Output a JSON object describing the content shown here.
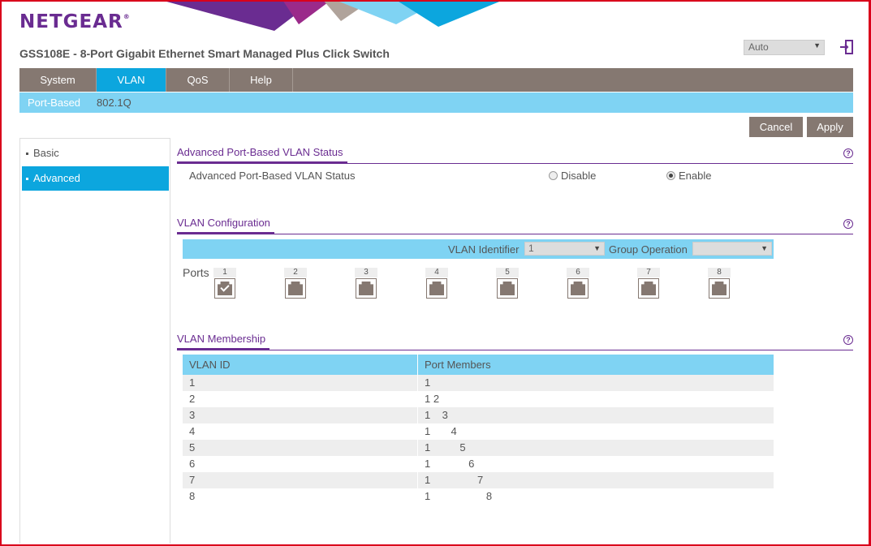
{
  "brand": {
    "logo": "NETGEAR",
    "trademark": "®",
    "colors": {
      "purple": "#6a2c91",
      "blue": "#0ca6de",
      "light_blue": "#7fd3f3",
      "taupe": "#857871"
    }
  },
  "product_title": "GSS108E - 8-Port Gigabit Ethernet Smart Managed Plus Click Switch",
  "language_select": {
    "value": "Auto"
  },
  "logout_icon": "logout-icon",
  "main_nav": [
    {
      "label": "System",
      "active": false
    },
    {
      "label": "VLAN",
      "active": true
    },
    {
      "label": "QoS",
      "active": false
    },
    {
      "label": "Help",
      "active": false
    }
  ],
  "sub_nav": [
    {
      "label": "Port-Based",
      "active": true
    },
    {
      "label": "802.1Q",
      "active": false
    }
  ],
  "buttons": {
    "cancel": "Cancel",
    "apply": "Apply"
  },
  "left_menu": [
    {
      "label": "Basic",
      "active": false
    },
    {
      "label": "Advanced",
      "active": true
    }
  ],
  "status_section": {
    "title": "Advanced Port-Based VLAN Status",
    "row_label": "Advanced Port-Based VLAN Status",
    "options": [
      {
        "label": "Disable",
        "selected": false
      },
      {
        "label": "Enable",
        "selected": true
      }
    ]
  },
  "config_section": {
    "title": "VLAN Configuration",
    "vlan_identifier_label": "VLAN Identifier",
    "vlan_identifier_value": "1",
    "group_operation_label": "Group Operation",
    "group_operation_value": "",
    "ports_label": "Ports",
    "ports": [
      {
        "num": "1",
        "checked": true
      },
      {
        "num": "2",
        "checked": false
      },
      {
        "num": "3",
        "checked": false
      },
      {
        "num": "4",
        "checked": false
      },
      {
        "num": "5",
        "checked": false
      },
      {
        "num": "6",
        "checked": false
      },
      {
        "num": "7",
        "checked": false
      },
      {
        "num": "8",
        "checked": false
      }
    ]
  },
  "membership_section": {
    "title": "VLAN Membership",
    "columns": [
      "VLAN ID",
      "Port Members"
    ],
    "rows": [
      [
        "1",
        "1"
      ],
      [
        "2",
        "1 2"
      ],
      [
        "3",
        "1    3"
      ],
      [
        "4",
        "1       4"
      ],
      [
        "5",
        "1          5"
      ],
      [
        "6",
        "1             6"
      ],
      [
        "7",
        "1                7"
      ],
      [
        "8",
        "1                   8"
      ]
    ]
  }
}
